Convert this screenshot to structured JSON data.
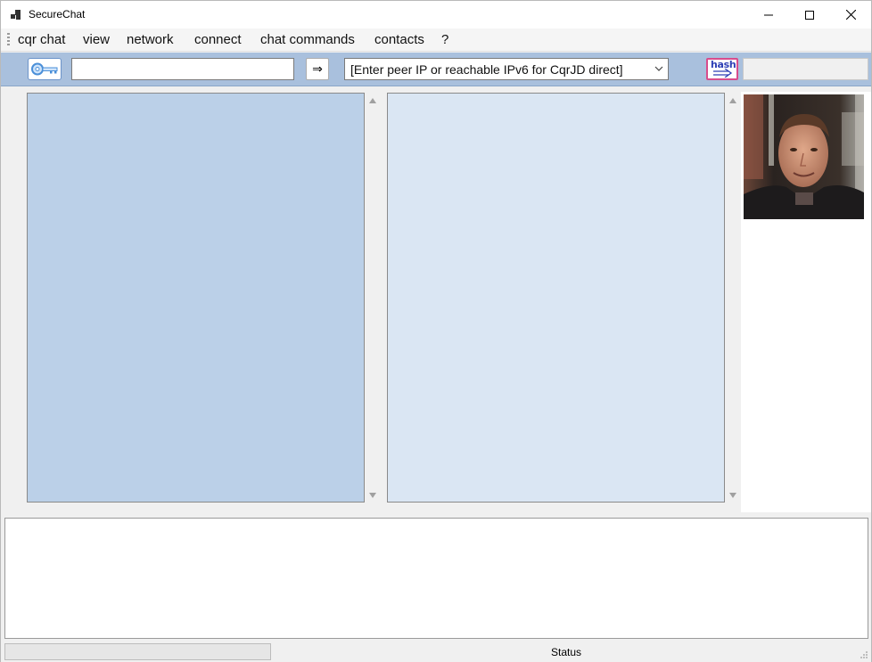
{
  "window": {
    "title": "SecureChat"
  },
  "menu": {
    "items": [
      "cqr chat",
      "view",
      "network",
      "connect",
      "chat commands",
      "contacts",
      "?"
    ]
  },
  "toolbar": {
    "key_icon": "key-icon",
    "input_value": "",
    "send_arrow": "⇒",
    "peer_combo": {
      "selected": "[Enter peer IP or reachable IPv6 for CqrJD direct]"
    },
    "hash_button_label": "hash",
    "right_field_value": ""
  },
  "content": {
    "left_panel_text": "",
    "middle_panel_text": "",
    "avatar_icon": "user-photo"
  },
  "bottom": {
    "message_text": ""
  },
  "statusbar": {
    "progress": 0,
    "status_text": "Status"
  },
  "colors": {
    "toolbar_bg": "#a9c0dd",
    "left_panel_bg": "#bbd0e8",
    "middle_panel_bg": "#dae6f3",
    "hash_border": "#d84c8c",
    "hash_text": "#2d3fb5"
  }
}
